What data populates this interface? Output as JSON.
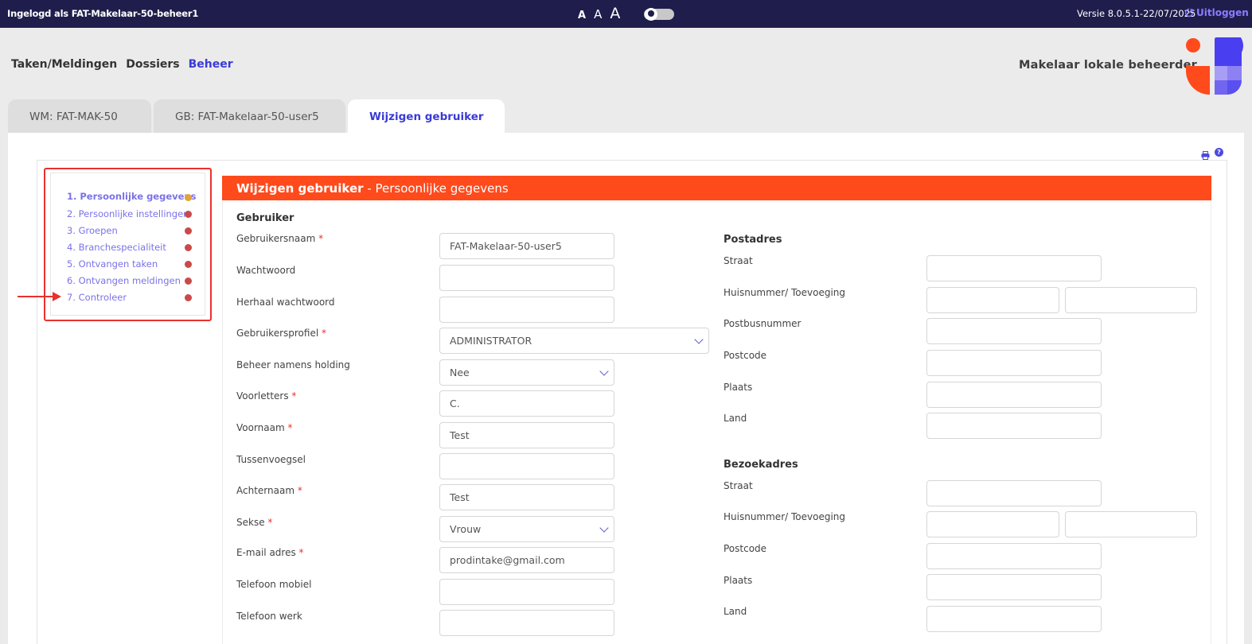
{
  "topbar": {
    "logged_in": "Ingelogd als FAT-Makelaar-50-beheer1",
    "font_sizes": [
      "A",
      "A",
      "A"
    ],
    "version": "Versie 8.0.5.1-22/07/2025",
    "logout": "Uitloggen"
  },
  "nav": {
    "items": [
      "Taken/Meldingen",
      "Dossiers",
      "Beheer"
    ],
    "active": "Beheer"
  },
  "role": "Makelaar lokale beheerder",
  "tabs": [
    "WM: FAT-MAK-50",
    "GB: FAT-Makelaar-50-user5",
    "Wijzigen gebruiker"
  ],
  "steps": [
    "1. Persoonlijke gegevens",
    "2. Persoonlijke instellingen",
    "3. Groepen",
    "4. Branchespecialiteit",
    "5. Ontvangen taken",
    "6. Ontvangen meldingen",
    "7. Controleer"
  ],
  "colors": {
    "accent": "#ff4a1c",
    "brand": "#3a3ad8",
    "topbar": "#1f1d4b",
    "step_done": "#c94a4a",
    "step_current": "#e0a43a"
  },
  "panel": {
    "title_bold": "Wijzigen gebruiker",
    "title_rest": " - Persoonlijke gegevens"
  },
  "form": {
    "section": "Gebruiker",
    "fields": [
      {
        "label": "Gebruikersnaam",
        "required": "*",
        "value": "FAT-Makelaar-50-user5"
      },
      {
        "label": "Wachtwoord",
        "required": "",
        "value": ""
      },
      {
        "label": "Herhaal wachtwoord",
        "required": "",
        "value": ""
      },
      {
        "label": "Gebruikersprofiel",
        "required": "*",
        "value": "ADMINISTRATOR"
      },
      {
        "label": "Beheer namens holding",
        "required": "",
        "value": "Nee"
      },
      {
        "label": "Voorletters",
        "required": "*",
        "value": "C."
      },
      {
        "label": "Voornaam",
        "required": "*",
        "value": "Test"
      },
      {
        "label": "Tussenvoegsel",
        "required": "",
        "value": ""
      },
      {
        "label": "Achternaam",
        "required": "*",
        "value": "Test"
      },
      {
        "label": "Sekse",
        "required": "*",
        "value": "Vrouw"
      },
      {
        "label": "E-mail adres",
        "required": "*",
        "value": "prodintake@gmail.com"
      },
      {
        "label": "Telefoon mobiel",
        "required": "",
        "value": ""
      },
      {
        "label": "Telefoon werk",
        "required": "",
        "value": ""
      }
    ]
  },
  "postadres": {
    "section": "Postadres",
    "labels": [
      "Straat",
      "Huisnummer/ Toevoeging",
      "Postbusnummer",
      "Postcode",
      "Plaats",
      "Land"
    ]
  },
  "bezoekadres": {
    "section": "Bezoekadres",
    "labels": [
      "Straat",
      "Huisnummer/ Toevoeging",
      "Postcode",
      "Plaats",
      "Land"
    ]
  }
}
